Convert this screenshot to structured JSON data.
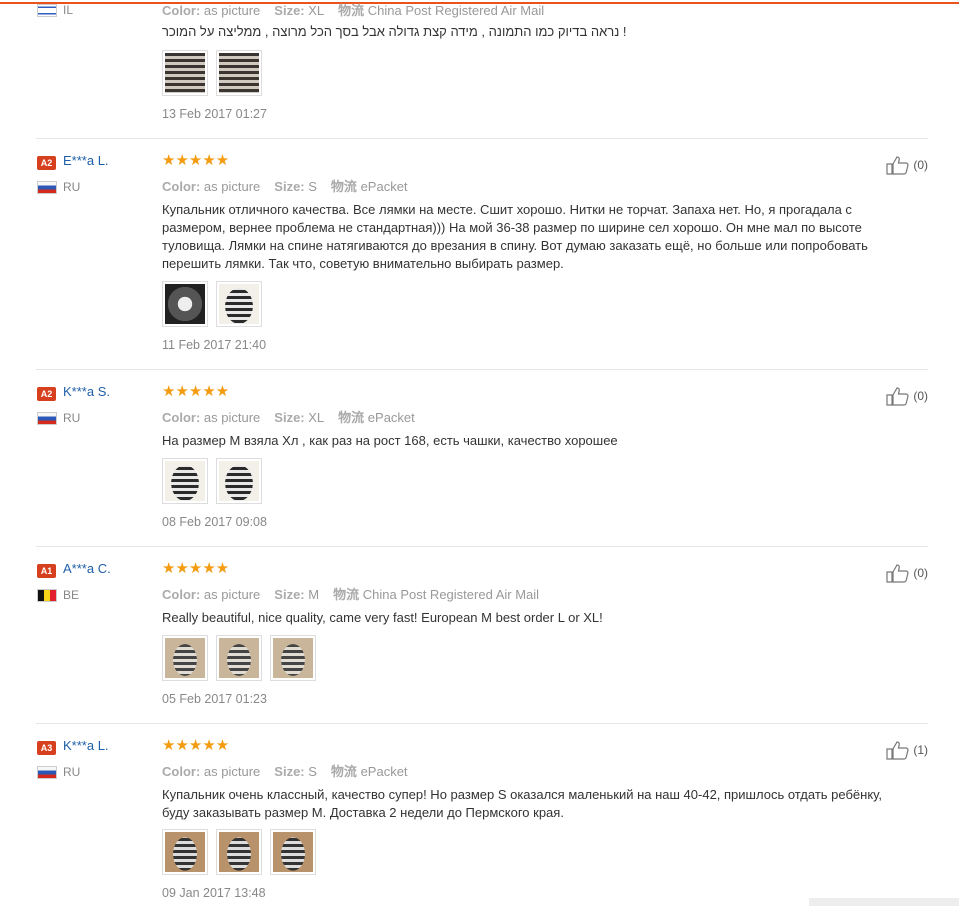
{
  "reviews": [
    {
      "badge": "",
      "user": "",
      "flag": "il",
      "country": "IL",
      "color_label": "Color:",
      "color": "as picture",
      "size_label": "Size:",
      "size": "XL",
      "ship_label": "物流",
      "ship": "China Post Registered Air Mail",
      "text": "! נראה בדיוק כמו התמונה , מידה קצת גדולה אבל בסך הכל מרוצה , ממליצה על המוכר",
      "photos": [
        "t-stripe",
        "t-stripe"
      ],
      "date": "13 Feb 2017 01:27",
      "likes": ""
    },
    {
      "badge": "A2",
      "user": "E***a L.",
      "flag": "ru",
      "country": "RU",
      "rating": "★★★★★",
      "color_label": "Color:",
      "color": "as picture",
      "size_label": "Size:",
      "size": "S",
      "ship_label": "物流",
      "ship": "ePacket",
      "text": "Купальник отличного качества. Все лямки на месте. Сшит хорошо. Нитки не торчат. Запаха нет. Но, я прогадала с размером, вернее проблема не стандартная))) На мой 36-38 размер по ширине сел хорошо. Он мне мал по высоте туловища. Лямки на спине натягиваются до врезания в спину. Вот думаю заказать ещё, но больше или попробовать перешить лямки. Так что, советую внимательно выбирать размер.",
      "photos": [
        "t-dark",
        "t-suit2"
      ],
      "date": "11 Feb 2017 21:40",
      "likes": "(0)"
    },
    {
      "badge": "A2",
      "user": "K***a S.",
      "flag": "ru",
      "country": "RU",
      "rating": "★★★★★",
      "color_label": "Color:",
      "color": "as picture",
      "size_label": "Size:",
      "size": "XL",
      "ship_label": "物流",
      "ship": "ePacket",
      "text": "На размер M взяла Хл , как раз на рост 168, есть чашки, качество хорошее",
      "photos": [
        "t-suit2",
        "t-suit2"
      ],
      "date": "08 Feb 2017 09:08",
      "likes": "(0)"
    },
    {
      "badge": "A1",
      "user": "A***a C.",
      "flag": "be",
      "country": "BE",
      "rating": "★★★★★",
      "color_label": "Color:",
      "color": "as picture",
      "size_label": "Size:",
      "size": "M",
      "ship_label": "物流",
      "ship": "China Post Registered Air Mail",
      "text": "Really beautiful, nice quality, came very fast! European M best order L or XL!",
      "photos": [
        "t-tan",
        "t-tan",
        "t-tan"
      ],
      "date": "05 Feb 2017 01:23",
      "likes": "(0)"
    },
    {
      "badge": "A3",
      "user": "K***a L.",
      "flag": "ru",
      "country": "RU",
      "rating": "★★★★★",
      "color_label": "Color:",
      "color": "as picture",
      "size_label": "Size:",
      "size": "S",
      "ship_label": "物流",
      "ship": "ePacket",
      "text": "Купальник очень классный, качество супер! Но размер S оказался маленький на наш 40-42, пришлось отдать ребёнку, буду заказывать размер M. Доставка 2 недели до Пермского края.",
      "photos": [
        "t-tan2",
        "t-tan2",
        "t-tan2"
      ],
      "date": "09 Jan 2017 13:48",
      "likes": "(1)"
    }
  ]
}
